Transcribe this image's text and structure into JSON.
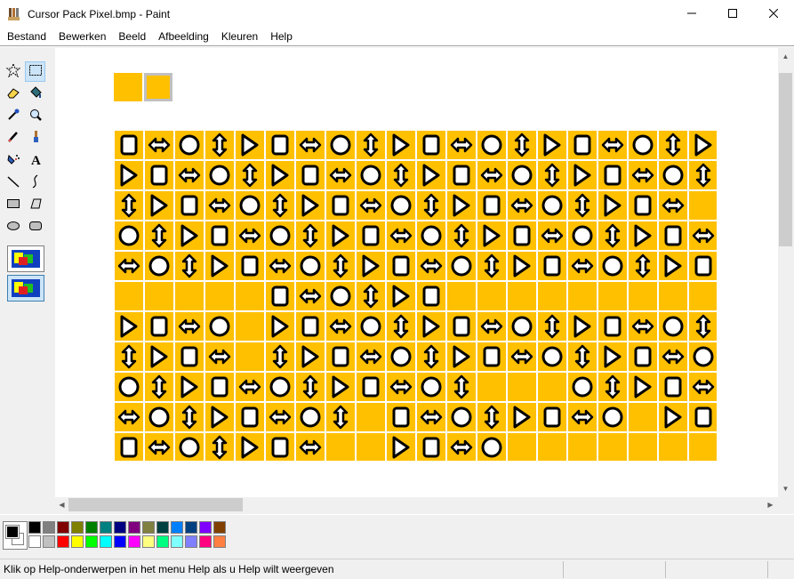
{
  "window": {
    "title": "Cursor Pack Pixel.bmp - Paint",
    "controls": {
      "minimize": "minimize",
      "maximize": "maximize",
      "close": "close"
    }
  },
  "menu": {
    "items": [
      "Bestand",
      "Bewerken",
      "Beeld",
      "Afbeelding",
      "Kleuren",
      "Help"
    ]
  },
  "tools": [
    {
      "id": "free-select",
      "icon": "star-select-icon"
    },
    {
      "id": "select",
      "icon": "rect-select-icon",
      "selected": true
    },
    {
      "id": "eraser",
      "icon": "eraser-icon"
    },
    {
      "id": "fill",
      "icon": "fill-bucket-icon"
    },
    {
      "id": "pick-color",
      "icon": "eyedropper-icon"
    },
    {
      "id": "magnifier",
      "icon": "magnifier-icon"
    },
    {
      "id": "pencil",
      "icon": "pencil-icon"
    },
    {
      "id": "brush",
      "icon": "brush-icon"
    },
    {
      "id": "airbrush",
      "icon": "airbrush-icon"
    },
    {
      "id": "text",
      "icon": "text-icon",
      "label": "A"
    },
    {
      "id": "line",
      "icon": "line-icon"
    },
    {
      "id": "curve",
      "icon": "curve-icon"
    },
    {
      "id": "rectangle",
      "icon": "rectangle-icon"
    },
    {
      "id": "polygon",
      "icon": "polygon-icon"
    },
    {
      "id": "ellipse",
      "icon": "ellipse-icon"
    },
    {
      "id": "rounded-rect",
      "icon": "rounded-rectangle-icon"
    }
  ],
  "palette": {
    "foreground": "#000000",
    "background": "#ffffff",
    "row1": [
      "#000000",
      "#808080",
      "#800000",
      "#808000",
      "#008000",
      "#008080",
      "#000080",
      "#800080",
      "#808040",
      "#004040",
      "#0080ff",
      "#004080",
      "#8000ff",
      "#804000"
    ],
    "row2": [
      "#ffffff",
      "#c0c0c0",
      "#ff0000",
      "#ffff00",
      "#00ff00",
      "#00ffff",
      "#0000ff",
      "#ff00ff",
      "#ffff80",
      "#00ff80",
      "#80ffff",
      "#8080ff",
      "#ff0080",
      "#ff8040"
    ]
  },
  "image": {
    "accent": "#ffc000",
    "swatch_colors": [
      "#ffc000",
      "#ffc000"
    ]
  },
  "status": {
    "text": "Klik op Help-onderwerpen in het menu Help als u Help wilt weergeven"
  }
}
